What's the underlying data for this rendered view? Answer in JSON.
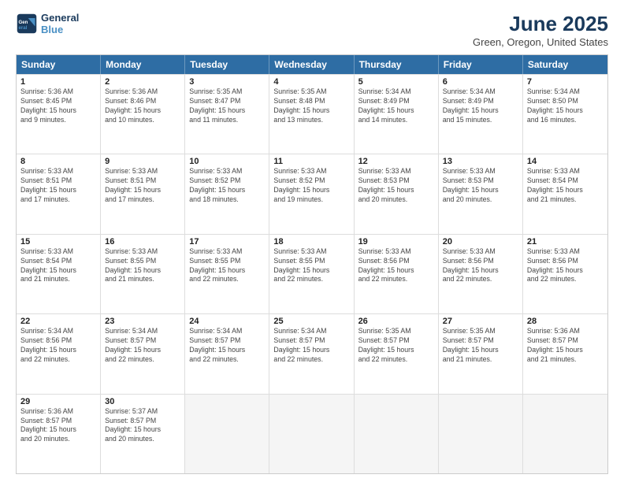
{
  "logo": {
    "line1": "General",
    "line2": "Blue"
  },
  "title": "June 2025",
  "subtitle": "Green, Oregon, United States",
  "weekdays": [
    "Sunday",
    "Monday",
    "Tuesday",
    "Wednesday",
    "Thursday",
    "Friday",
    "Saturday"
  ],
  "rows": [
    [
      {
        "day": "",
        "info": ""
      },
      {
        "day": "2",
        "info": "Sunrise: 5:36 AM\nSunset: 8:46 PM\nDaylight: 15 hours\nand 10 minutes."
      },
      {
        "day": "3",
        "info": "Sunrise: 5:35 AM\nSunset: 8:47 PM\nDaylight: 15 hours\nand 11 minutes."
      },
      {
        "day": "4",
        "info": "Sunrise: 5:35 AM\nSunset: 8:48 PM\nDaylight: 15 hours\nand 13 minutes."
      },
      {
        "day": "5",
        "info": "Sunrise: 5:34 AM\nSunset: 8:49 PM\nDaylight: 15 hours\nand 14 minutes."
      },
      {
        "day": "6",
        "info": "Sunrise: 5:34 AM\nSunset: 8:49 PM\nDaylight: 15 hours\nand 15 minutes."
      },
      {
        "day": "7",
        "info": "Sunrise: 5:34 AM\nSunset: 8:50 PM\nDaylight: 15 hours\nand 16 minutes."
      }
    ],
    [
      {
        "day": "1",
        "info": "Sunrise: 5:36 AM\nSunset: 8:45 PM\nDaylight: 15 hours\nand 9 minutes."
      },
      {
        "day": "",
        "info": ""
      },
      {
        "day": "",
        "info": ""
      },
      {
        "day": "",
        "info": ""
      },
      {
        "day": "",
        "info": ""
      },
      {
        "day": "",
        "info": ""
      },
      {
        "day": "",
        "info": ""
      }
    ],
    [
      {
        "day": "8",
        "info": "Sunrise: 5:33 AM\nSunset: 8:51 PM\nDaylight: 15 hours\nand 17 minutes."
      },
      {
        "day": "9",
        "info": "Sunrise: 5:33 AM\nSunset: 8:51 PM\nDaylight: 15 hours\nand 17 minutes."
      },
      {
        "day": "10",
        "info": "Sunrise: 5:33 AM\nSunset: 8:52 PM\nDaylight: 15 hours\nand 18 minutes."
      },
      {
        "day": "11",
        "info": "Sunrise: 5:33 AM\nSunset: 8:52 PM\nDaylight: 15 hours\nand 19 minutes."
      },
      {
        "day": "12",
        "info": "Sunrise: 5:33 AM\nSunset: 8:53 PM\nDaylight: 15 hours\nand 20 minutes."
      },
      {
        "day": "13",
        "info": "Sunrise: 5:33 AM\nSunset: 8:53 PM\nDaylight: 15 hours\nand 20 minutes."
      },
      {
        "day": "14",
        "info": "Sunrise: 5:33 AM\nSunset: 8:54 PM\nDaylight: 15 hours\nand 21 minutes."
      }
    ],
    [
      {
        "day": "15",
        "info": "Sunrise: 5:33 AM\nSunset: 8:54 PM\nDaylight: 15 hours\nand 21 minutes."
      },
      {
        "day": "16",
        "info": "Sunrise: 5:33 AM\nSunset: 8:55 PM\nDaylight: 15 hours\nand 21 minutes."
      },
      {
        "day": "17",
        "info": "Sunrise: 5:33 AM\nSunset: 8:55 PM\nDaylight: 15 hours\nand 22 minutes."
      },
      {
        "day": "18",
        "info": "Sunrise: 5:33 AM\nSunset: 8:55 PM\nDaylight: 15 hours\nand 22 minutes."
      },
      {
        "day": "19",
        "info": "Sunrise: 5:33 AM\nSunset: 8:56 PM\nDaylight: 15 hours\nand 22 minutes."
      },
      {
        "day": "20",
        "info": "Sunrise: 5:33 AM\nSunset: 8:56 PM\nDaylight: 15 hours\nand 22 minutes."
      },
      {
        "day": "21",
        "info": "Sunrise: 5:33 AM\nSunset: 8:56 PM\nDaylight: 15 hours\nand 22 minutes."
      }
    ],
    [
      {
        "day": "22",
        "info": "Sunrise: 5:34 AM\nSunset: 8:56 PM\nDaylight: 15 hours\nand 22 minutes."
      },
      {
        "day": "23",
        "info": "Sunrise: 5:34 AM\nSunset: 8:57 PM\nDaylight: 15 hours\nand 22 minutes."
      },
      {
        "day": "24",
        "info": "Sunrise: 5:34 AM\nSunset: 8:57 PM\nDaylight: 15 hours\nand 22 minutes."
      },
      {
        "day": "25",
        "info": "Sunrise: 5:34 AM\nSunset: 8:57 PM\nDaylight: 15 hours\nand 22 minutes."
      },
      {
        "day": "26",
        "info": "Sunrise: 5:35 AM\nSunset: 8:57 PM\nDaylight: 15 hours\nand 22 minutes."
      },
      {
        "day": "27",
        "info": "Sunrise: 5:35 AM\nSunset: 8:57 PM\nDaylight: 15 hours\nand 21 minutes."
      },
      {
        "day": "28",
        "info": "Sunrise: 5:36 AM\nSunset: 8:57 PM\nDaylight: 15 hours\nand 21 minutes."
      }
    ],
    [
      {
        "day": "29",
        "info": "Sunrise: 5:36 AM\nSunset: 8:57 PM\nDaylight: 15 hours\nand 20 minutes."
      },
      {
        "day": "30",
        "info": "Sunrise: 5:37 AM\nSunset: 8:57 PM\nDaylight: 15 hours\nand 20 minutes."
      },
      {
        "day": "",
        "info": ""
      },
      {
        "day": "",
        "info": ""
      },
      {
        "day": "",
        "info": ""
      },
      {
        "day": "",
        "info": ""
      },
      {
        "day": "",
        "info": ""
      }
    ]
  ]
}
